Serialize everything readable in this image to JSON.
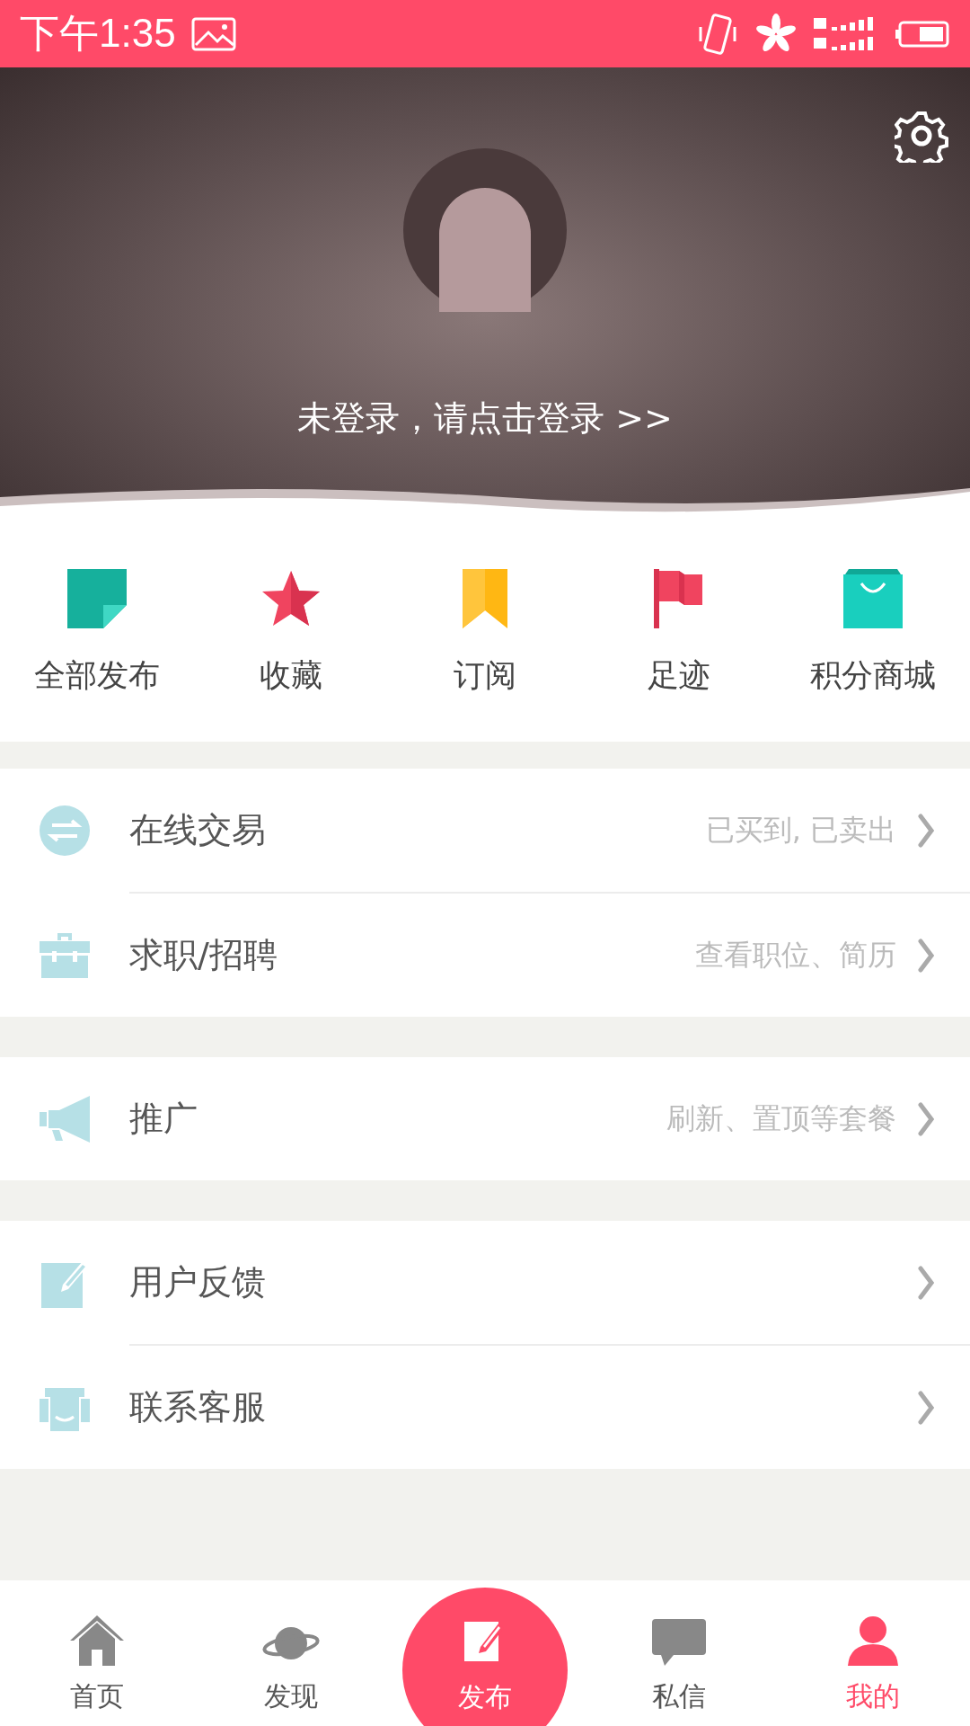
{
  "status_bar": {
    "time": "下午1:35"
  },
  "header": {
    "login_prompt": "未登录，请点击登录 >>"
  },
  "shortcuts": [
    {
      "label": "全部发布",
      "kind": "note"
    },
    {
      "label": "收藏",
      "kind": "star"
    },
    {
      "label": "订阅",
      "kind": "bookmark"
    },
    {
      "label": "足迹",
      "kind": "flag"
    },
    {
      "label": "积分商城",
      "kind": "bag"
    }
  ],
  "menu_groups": [
    [
      {
        "kind": "trade",
        "title": "在线交易",
        "hint": "已买到, 已卖出"
      },
      {
        "kind": "job",
        "title": "求职/招聘",
        "hint": "查看职位、简历"
      }
    ],
    [
      {
        "kind": "promote",
        "title": "推广",
        "hint": "刷新、置顶等套餐"
      }
    ],
    [
      {
        "kind": "feedback",
        "title": "用户反馈"
      },
      {
        "kind": "service",
        "title": "联系客服"
      }
    ]
  ],
  "tabs": [
    {
      "label": "首页",
      "kind": "home",
      "selected": false
    },
    {
      "label": "发现",
      "kind": "discover",
      "selected": false
    },
    {
      "label": "发布",
      "kind": "publish"
    },
    {
      "label": "私信",
      "kind": "message",
      "selected": false
    },
    {
      "label": "我的",
      "kind": "me",
      "selected": true
    }
  ]
}
